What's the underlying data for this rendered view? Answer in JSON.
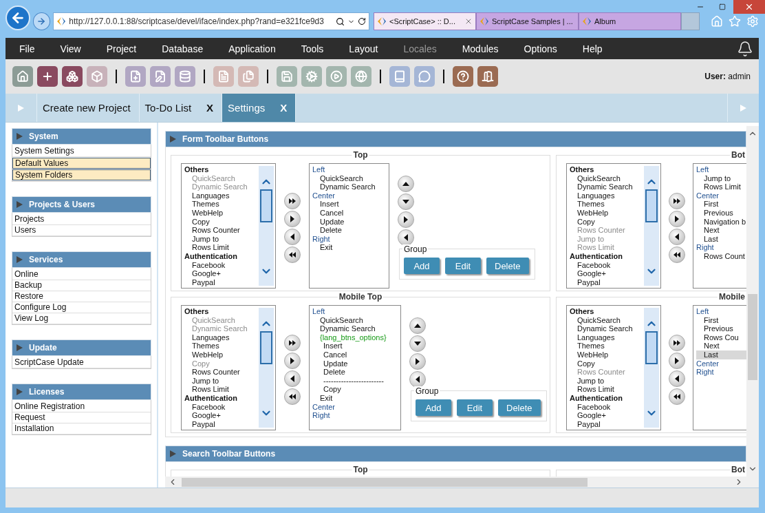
{
  "browser": {
    "address": "http://127.0.0.1:88/scriptcase/devel/iface/index.php?rand=e321fce9d3",
    "tabs": [
      {
        "label": "<ScriptCase> :: D...",
        "selected": true
      },
      {
        "label": "ScriptCase Samples | ...",
        "selected": false
      },
      {
        "label": "Album",
        "selected": false
      }
    ]
  },
  "menu": [
    {
      "label": "File",
      "disabled": false
    },
    {
      "label": "View",
      "disabled": false
    },
    {
      "label": "Project",
      "disabled": false
    },
    {
      "label": "Database",
      "disabled": false
    },
    {
      "label": "Application",
      "disabled": false
    },
    {
      "label": "Tools",
      "disabled": false
    },
    {
      "label": "Layout",
      "disabled": false
    },
    {
      "label": "Locales",
      "disabled": true
    },
    {
      "label": "Modules",
      "disabled": false
    },
    {
      "label": "Options",
      "disabled": false
    },
    {
      "label": "Help",
      "disabled": false
    }
  ],
  "user": {
    "label": "User:",
    "name": "admin"
  },
  "tabs": [
    {
      "label": "Create new Project",
      "selected": false
    },
    {
      "label": "To-Do List",
      "close": "X",
      "selected": false
    },
    {
      "label": "Settings",
      "close": "X",
      "selected": true
    }
  ],
  "sidebar": [
    {
      "title": "System",
      "items": [
        {
          "label": "System Settings",
          "selected": false
        },
        {
          "label": "Default Values",
          "selected": true
        },
        {
          "label": "System Folders",
          "selected": true
        }
      ]
    },
    {
      "title": "Projects & Users",
      "items": [
        {
          "label": "Projects",
          "selected": false
        },
        {
          "label": "Users",
          "selected": false
        }
      ]
    },
    {
      "title": "Services",
      "items": [
        {
          "label": "Online",
          "selected": false
        },
        {
          "label": "Backup",
          "selected": false
        },
        {
          "label": "Restore",
          "selected": false
        },
        {
          "label": "Configure Log",
          "selected": false
        },
        {
          "label": "View Log",
          "selected": false
        }
      ]
    },
    {
      "title": "Update",
      "items": [
        {
          "label": "ScriptCase Update",
          "selected": false
        }
      ]
    },
    {
      "title": "Licenses",
      "items": [
        {
          "label": "Online Registration",
          "selected": false
        },
        {
          "label": "Request",
          "selected": false
        },
        {
          "label": "Installation",
          "selected": false
        }
      ]
    }
  ],
  "sections": [
    {
      "title": "Form Toolbar Buttons",
      "panels": [
        {
          "title": "Top",
          "available": [
            {
              "label": "Others",
              "children": [
                {
                  "label": "QuickSearch",
                  "disabled": true
                },
                {
                  "label": "Dynamic Search",
                  "disabled": true
                },
                {
                  "label": "Languages",
                  "disabled": false
                },
                {
                  "label": "Themes",
                  "disabled": false
                },
                {
                  "label": "WebHelp",
                  "disabled": false
                },
                {
                  "label": "Copy",
                  "disabled": false
                },
                {
                  "label": "Rows Counter",
                  "disabled": false
                },
                {
                  "label": "Jump to",
                  "disabled": false
                },
                {
                  "label": "Rows Limit",
                  "disabled": false
                }
              ]
            },
            {
              "label": "Authentication",
              "children": [
                {
                  "label": "Facebook",
                  "disabled": false
                },
                {
                  "label": "Google+",
                  "disabled": false
                },
                {
                  "label": "Paypal",
                  "disabled": false
                }
              ]
            }
          ],
          "chosen": [
            {
              "label": "Left",
              "children": [
                {
                  "label": "QuickSearch",
                  "selected": false
                },
                {
                  "label": "Dynamic Search",
                  "selected": false
                }
              ]
            },
            {
              "label": "Center",
              "children": [
                {
                  "label": "Insert",
                  "selected": false
                },
                {
                  "label": "Cancel",
                  "selected": false
                },
                {
                  "label": "Update",
                  "selected": false
                },
                {
                  "label": "Delete",
                  "selected": false
                }
              ]
            },
            {
              "label": "Right",
              "children": [
                {
                  "label": "Exit",
                  "selected": false
                }
              ]
            }
          ],
          "group": {
            "title": "Group",
            "buttons": [
              "Add",
              "Edit",
              "Delete"
            ]
          }
        },
        {
          "title": "Bot",
          "available": [
            {
              "label": "Others",
              "children": [
                {
                  "label": "QuickSearch",
                  "disabled": false
                },
                {
                  "label": "Dynamic Search",
                  "disabled": false
                },
                {
                  "label": "Languages",
                  "disabled": false
                },
                {
                  "label": "Themes",
                  "disabled": false
                },
                {
                  "label": "WebHelp",
                  "disabled": false
                },
                {
                  "label": "Copy",
                  "disabled": false
                },
                {
                  "label": "Rows Counter",
                  "disabled": true
                },
                {
                  "label": "Jump to",
                  "disabled": true
                },
                {
                  "label": "Rows Limit",
                  "disabled": true
                }
              ]
            },
            {
              "label": "Authentication",
              "children": [
                {
                  "label": "Facebook",
                  "disabled": false
                },
                {
                  "label": "Google+",
                  "disabled": false
                },
                {
                  "label": "Paypal",
                  "disabled": false
                }
              ]
            }
          ],
          "chosen": [
            {
              "label": "Left",
              "children": [
                {
                  "label": "Jump to",
                  "selected": false
                },
                {
                  "label": "Rows Limit",
                  "selected": false
                }
              ]
            },
            {
              "label": "Center",
              "children": [
                {
                  "label": "First",
                  "selected": false
                },
                {
                  "label": "Previous",
                  "selected": false
                },
                {
                  "label": "Navigation b",
                  "selected": false
                },
                {
                  "label": "Next",
                  "selected": false
                },
                {
                  "label": "Last",
                  "selected": false
                }
              ]
            },
            {
              "label": "Right",
              "children": [
                {
                  "label": "Rows Count",
                  "selected": false
                }
              ]
            }
          ]
        },
        {
          "title": "Mobile Top",
          "available": [
            {
              "label": "Others",
              "children": [
                {
                  "label": "QuickSearch",
                  "disabled": true
                },
                {
                  "label": "Dynamic Search",
                  "disabled": true
                },
                {
                  "label": "Languages",
                  "disabled": false
                },
                {
                  "label": "Themes",
                  "disabled": false
                },
                {
                  "label": "WebHelp",
                  "disabled": false
                },
                {
                  "label": "Copy",
                  "disabled": true
                },
                {
                  "label": "Rows Counter",
                  "disabled": false
                },
                {
                  "label": "Jump to",
                  "disabled": false
                },
                {
                  "label": "Rows Limit",
                  "disabled": false
                }
              ]
            },
            {
              "label": "Authentication",
              "children": [
                {
                  "label": "Facebook",
                  "disabled": false
                },
                {
                  "label": "Google+",
                  "disabled": false
                },
                {
                  "label": "Paypal",
                  "disabled": false
                }
              ]
            }
          ],
          "chosen": [
            {
              "label": "Left",
              "children": [
                {
                  "label": "QuickSearch",
                  "selected": false
                },
                {
                  "label": "Dynamic Search",
                  "selected": false
                },
                {
                  "label": "{lang_btns_options}",
                  "children": [
                    {
                      "label": "Insert",
                      "selected": false
                    },
                    {
                      "label": "Cancel",
                      "selected": false
                    },
                    {
                      "label": "Update",
                      "selected": false
                    },
                    {
                      "label": "Delete",
                      "selected": false
                    },
                    {
                      "label": "------------------------",
                      "selected": false
                    },
                    {
                      "label": "Copy",
                      "selected": false
                    }
                  ]
                },
                {
                  "label": "Exit",
                  "selected": false
                }
              ]
            },
            {
              "label": "Center"
            },
            {
              "label": "Right"
            }
          ],
          "group": {
            "title": "Group",
            "buttons": [
              "Add",
              "Edit",
              "Delete"
            ]
          }
        },
        {
          "title": "Mobile",
          "available": [
            {
              "label": "Others",
              "children": [
                {
                  "label": "QuickSearch",
                  "disabled": false
                },
                {
                  "label": "Dynamic Search",
                  "disabled": false
                },
                {
                  "label": "Languages",
                  "disabled": false
                },
                {
                  "label": "Themes",
                  "disabled": false
                },
                {
                  "label": "WebHelp",
                  "disabled": false
                },
                {
                  "label": "Copy",
                  "disabled": false
                },
                {
                  "label": "Rows Counter",
                  "disabled": true
                },
                {
                  "label": "Jump to",
                  "disabled": false
                },
                {
                  "label": "Rows Limit",
                  "disabled": false
                }
              ]
            },
            {
              "label": "Authentication",
              "children": [
                {
                  "label": "Facebook",
                  "disabled": false
                },
                {
                  "label": "Google+",
                  "disabled": false
                },
                {
                  "label": "Paypal",
                  "disabled": false
                }
              ]
            }
          ],
          "chosen": [
            {
              "label": "Left",
              "children": [
                {
                  "label": "First",
                  "selected": false
                },
                {
                  "label": "Previous",
                  "selected": false
                },
                {
                  "label": "Rows Cou",
                  "selected": false
                },
                {
                  "label": "Next",
                  "selected": false
                },
                {
                  "label": "Last",
                  "selected": true
                }
              ]
            },
            {
              "label": "Center"
            },
            {
              "label": "Right"
            }
          ]
        }
      ]
    },
    {
      "title": "Search Toolbar Buttons",
      "panels": [
        {
          "title": "Top"
        },
        {
          "title": "Bot"
        }
      ]
    }
  ]
}
